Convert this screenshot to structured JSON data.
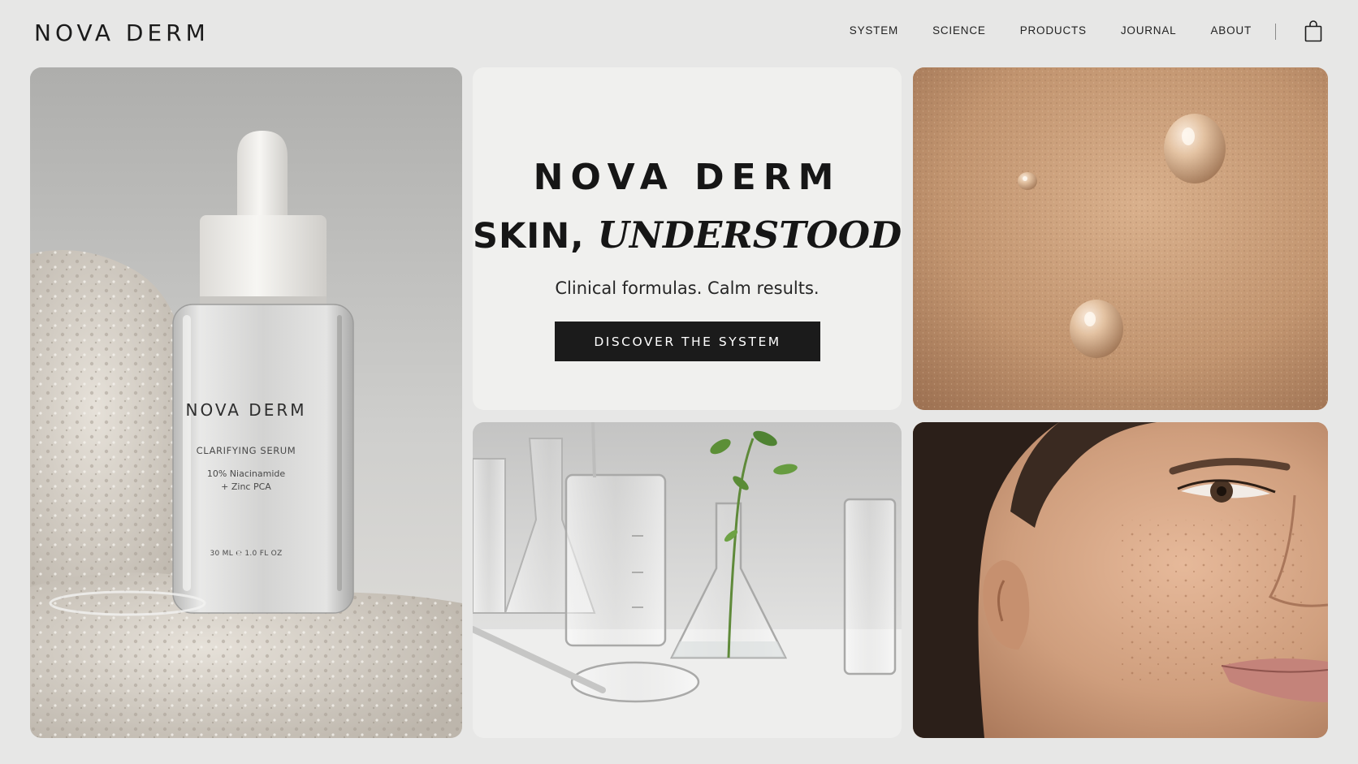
{
  "header": {
    "brand": "NOVA DERM",
    "nav": [
      "SYSTEM",
      "SCIENCE",
      "PRODUCTS",
      "JOURNAL",
      "ABOUT"
    ],
    "cart_icon": "shopping-bag-icon"
  },
  "hero": {
    "brand": "NOVA DERM",
    "tagline_plain": "SKIN, ",
    "tagline_italic": "UNDERSTOOD.",
    "subtitle": "Clinical formulas. Calm results.",
    "cta_label": "DISCOVER THE SYSTEM"
  },
  "product_label": {
    "brand": "NOVA DERM",
    "name": "CLARIFYING SERUM",
    "ingredient_line1": "10% Niacinamide",
    "ingredient_line2": "+ Zinc PCA",
    "volume": "30 ML  ℮  1.0 FL OZ"
  },
  "colors": {
    "background": "#e7e7e6",
    "hero_panel": "#f0f0ee",
    "cta_background": "#1b1b1b",
    "text": "#1a1a1a"
  }
}
